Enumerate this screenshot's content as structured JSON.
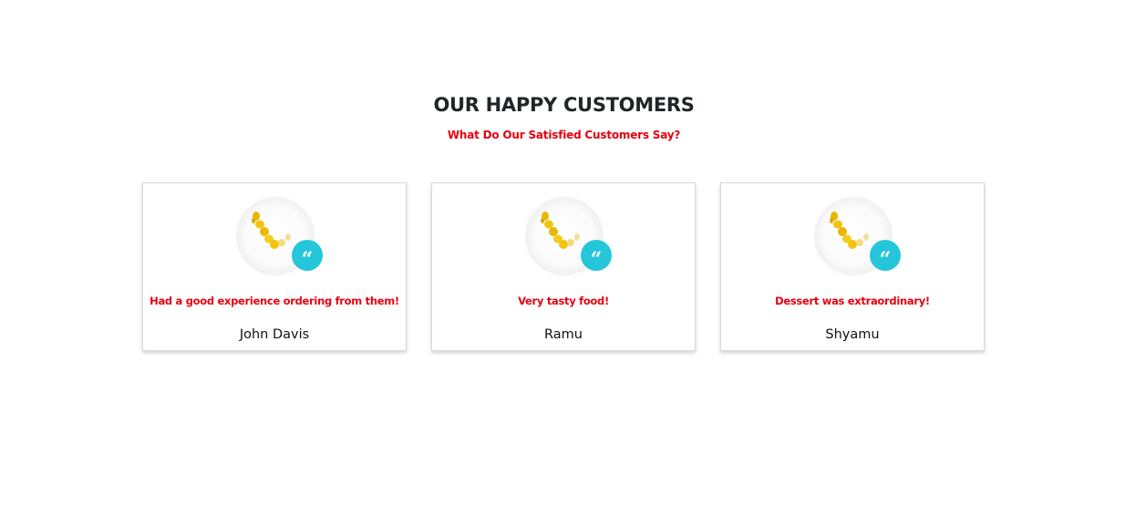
{
  "section": {
    "title": "OUR HAPPY CUSTOMERS",
    "subtitle": "What Do Our Satisfied Customers Say?"
  },
  "colors": {
    "accent": "#e8000e",
    "heading": "#212529",
    "quote_badge": "#25c6da"
  },
  "testimonials": [
    {
      "image": "plate-with-lemons",
      "badge_icon": "quote-icon",
      "badge_glyph": "“",
      "review": "Had a good experience ordering from them!",
      "name": "John Davis"
    },
    {
      "image": "plate-with-lemons",
      "badge_icon": "quote-icon",
      "badge_glyph": "“",
      "review": "Very tasty food!",
      "name": "Ramu"
    },
    {
      "image": "plate-with-lemons",
      "badge_icon": "quote-icon",
      "badge_glyph": "“",
      "review": "Dessert was extraordinary!",
      "name": "Shyamu"
    }
  ]
}
